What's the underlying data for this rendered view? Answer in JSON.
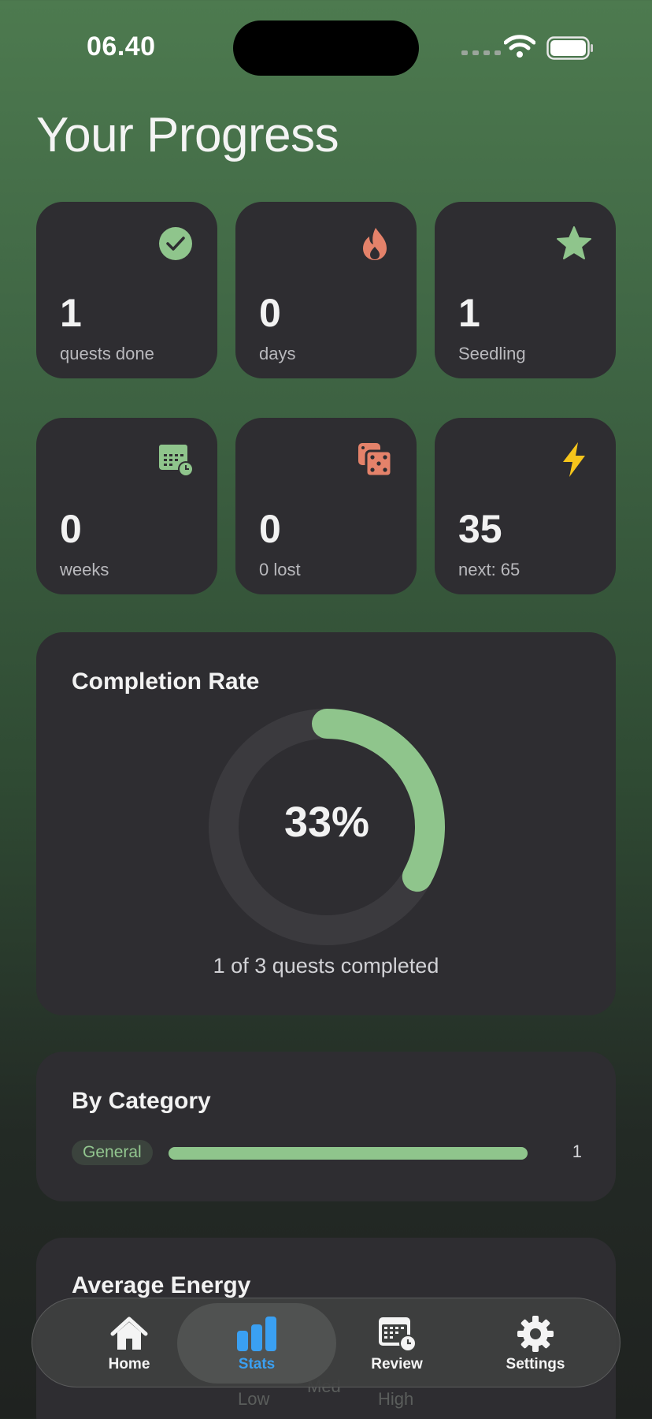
{
  "status": {
    "time": "06.40"
  },
  "page": {
    "title": "Your Progress"
  },
  "stats": [
    {
      "value": "1",
      "label": "quests done",
      "icon": "check-circle-icon"
    },
    {
      "value": "0",
      "label": "days",
      "icon": "flame-icon"
    },
    {
      "value": "1",
      "label": "Seedling",
      "icon": "star-icon"
    },
    {
      "value": "0",
      "label": "weeks",
      "icon": "calendar-clock-icon"
    },
    {
      "value": "0",
      "label": "0 lost",
      "icon": "dice-icon"
    },
    {
      "value": "35",
      "label": "next: 65",
      "icon": "lightning-icon"
    }
  ],
  "completion": {
    "title": "Completion Rate",
    "percent_label": "33%",
    "fraction": 0.33,
    "caption": "1 of 3 quests completed"
  },
  "category": {
    "title": "By Category",
    "items": [
      {
        "name": "General",
        "count": "1",
        "fraction": 1.0
      }
    ]
  },
  "energy": {
    "title": "Average Energy",
    "labels": [
      "Low",
      "Med",
      "High"
    ]
  },
  "tabbar": {
    "items": [
      {
        "label": "Home",
        "icon": "home-icon"
      },
      {
        "label": "Stats",
        "icon": "bar-chart-icon",
        "active": true
      },
      {
        "label": "Review",
        "icon": "calendar-clock-icon"
      },
      {
        "label": "Settings",
        "icon": "gear-icon"
      }
    ]
  },
  "colors": {
    "accent_green": "#8fc58c",
    "flame": "#e4826a",
    "lightning": "#f6c51b",
    "tab_active": "#3aa0f2",
    "card_bg": "#2e2d31"
  }
}
